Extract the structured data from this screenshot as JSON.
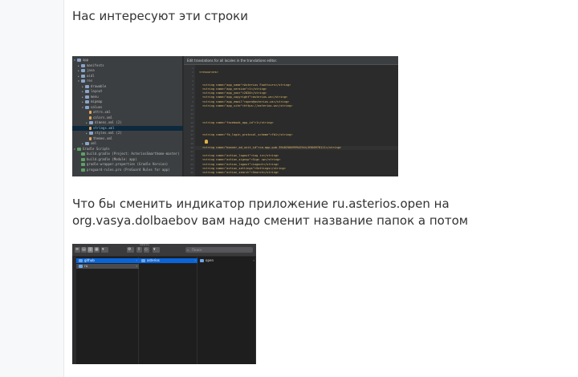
{
  "post": {
    "paragraph1": "Нас интересуют эти строки",
    "paragraph2": "Что бы сменить индикатор приложение ru.asterios.open на org.vasya.dolbaebov вам надо сменит название папок а потом"
  },
  "ide": {
    "banner": "Edit translations for all locales in the translations editor.",
    "tree": [
      {
        "label": "app",
        "indent": 0,
        "open": true,
        "icon": "folder"
      },
      {
        "label": "manifests",
        "indent": 1,
        "open": false,
        "icon": "folder"
      },
      {
        "label": "java",
        "indent": 1,
        "open": false,
        "icon": "folder"
      },
      {
        "label": "aidl",
        "indent": 1,
        "open": false,
        "icon": "folder"
      },
      {
        "label": "res",
        "indent": 1,
        "open": true,
        "icon": "folder"
      },
      {
        "label": "drawable",
        "indent": 2,
        "open": false,
        "icon": "folder"
      },
      {
        "label": "layout",
        "indent": 2,
        "open": false,
        "icon": "folder"
      },
      {
        "label": "menu",
        "indent": 2,
        "open": false,
        "icon": "folder"
      },
      {
        "label": "mipmap",
        "indent": 2,
        "open": false,
        "icon": "folder"
      },
      {
        "label": "values",
        "indent": 2,
        "open": true,
        "icon": "folder"
      },
      {
        "label": "attrs.xml",
        "indent": 3,
        "open": null,
        "icon": "file"
      },
      {
        "label": "colors.xml",
        "indent": 3,
        "open": null,
        "icon": "file"
      },
      {
        "label": "dimens.xml (2)",
        "indent": 3,
        "open": false,
        "icon": "folder"
      },
      {
        "label": "strings.xml",
        "indent": 3,
        "open": null,
        "icon": "file",
        "selected": true
      },
      {
        "label": "styles.xml (2)",
        "indent": 3,
        "open": false,
        "icon": "folder"
      },
      {
        "label": "themes.xml",
        "indent": 3,
        "open": null,
        "icon": "file"
      },
      {
        "label": "xml",
        "indent": 2,
        "open": false,
        "icon": "folder"
      },
      {
        "label": "Gradle Scripts",
        "indent": 0,
        "open": true,
        "icon": "gradle"
      },
      {
        "label": "build.gradle (Project: AsteriosSmarthome-master)",
        "indent": 1,
        "open": null,
        "icon": "gradle"
      },
      {
        "label": "build.gradle (Module: app)",
        "indent": 1,
        "open": null,
        "icon": "gradle"
      },
      {
        "label": "gradle-wrapper.properties (Gradle Version)",
        "indent": 1,
        "open": null,
        "icon": "gradle"
      },
      {
        "label": "proguard-rules.pro (ProGuard Rules for app)",
        "indent": 1,
        "open": null,
        "icon": "gradle"
      }
    ],
    "code": [
      {
        "line": "1",
        "text": ""
      },
      {
        "line": "2",
        "text": "<resources>"
      },
      {
        "line": "3",
        "text": ""
      },
      {
        "line": "4",
        "text": ""
      },
      {
        "line": "5",
        "text": "<string name=\"app_name\">Asterios Foottcurs</string>"
      },
      {
        "line": "6",
        "text": "<string name=\"app_version\">1</string>"
      },
      {
        "line": "7",
        "text": "<string name=\"app_year\">2020</string>"
      },
      {
        "line": "8",
        "text": "<string name=\"app_copyright\">asterios.ws</string>"
      },
      {
        "line": "9",
        "text": "<string name=\"app_email\">open@asterios.ws</string>"
      },
      {
        "line": "10",
        "text": "<string name=\"app_site\">https://asterios.ws</string>"
      },
      {
        "line": "11",
        "text": ""
      },
      {
        "line": "12",
        "text": ""
      },
      {
        "line": "13",
        "text": ""
      },
      {
        "line": "14",
        "text": "<string name=\"facebook_app_id\">1</string>"
      },
      {
        "line": "15",
        "text": ""
      },
      {
        "line": "16",
        "text": ""
      },
      {
        "line": "17",
        "text": "<string name=\"fb_login_protocol_scheme\">fb1</string>"
      },
      {
        "line": "18",
        "text": ""
      },
      {
        "line": "19",
        "text": ""
      },
      {
        "line": "20",
        "text": "<string name=\"banner_ad_unit_id\">ca-app-pub-3940256099942544/6300978111</string>"
      },
      {
        "line": "21",
        "text": ""
      },
      {
        "line": "22",
        "text": "<string name=\"action_logout\">Log in</string>"
      },
      {
        "line": "23",
        "text": "<string name=\"action_signup\">Sign up</string>"
      },
      {
        "line": "24",
        "text": "<string name=\"action_logout\">Logout</string>"
      },
      {
        "line": "25",
        "text": "<string name=\"action_settings\">Settings</string>"
      },
      {
        "line": "26",
        "text": "<string name=\"action_search\">Search</string>"
      }
    ]
  },
  "finder": {
    "path": "asterios",
    "search_placeholder": "Поиск",
    "col1": [
      {
        "label": "github",
        "selected": true,
        "folder": true
      },
      {
        "label": "ru",
        "selected": false,
        "folder": true,
        "hl2": true
      }
    ],
    "col2": [
      {
        "label": "asterios",
        "selected": true,
        "folder": true
      }
    ],
    "col3": [
      {
        "label": "open",
        "selected": false,
        "folder": true
      }
    ]
  }
}
